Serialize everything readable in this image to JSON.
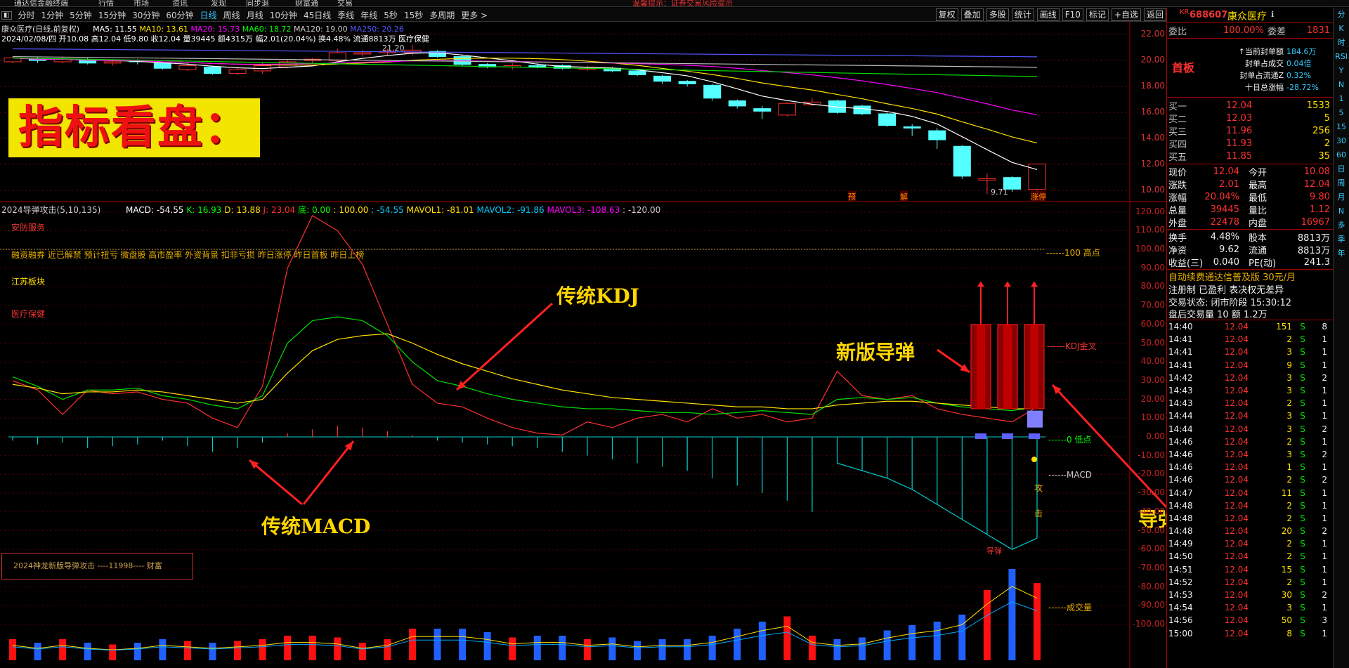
{
  "top_menu": [
    "通达信金融终端",
    "行情",
    "市场",
    "资讯",
    "发现",
    "同步退",
    "财富通",
    "交易",
    "温馨提示：证券交易风险提示"
  ],
  "toolbar": {
    "periods": [
      "分时",
      "1分钟",
      "5分钟",
      "15分钟",
      "30分钟",
      "60分钟",
      "日线",
      "周线",
      "月线",
      "10分钟",
      "45日线",
      "季线",
      "年线",
      "5秒",
      "15秒",
      "多周期",
      "更多 >"
    ],
    "right_buttons": [
      "复权",
      "叠加",
      "多股",
      "统计",
      "画线",
      "F10",
      "标记",
      "+自选",
      "返回"
    ]
  },
  "info_line1": {
    "name": "康众医疗(日线,前复权)",
    "ma5": "MA5: 11.55",
    "ma10": "MA10: 13.61",
    "ma20": "MA20: 15.73",
    "ma60": "MA60: 18.72",
    "ma120": "MA120: 19.00",
    "ma250": "MA250: 20.26"
  },
  "info_line2": "2024/02/08/四 开10.08 高12.04 低9.80 收12.04 量39445 额4315万 幅2.01(20.04%) 换4.48% 流通8813万 医疗保健",
  "title_box": "指标看盘：",
  "price_axis": [
    "22.00",
    "20.00",
    "18.00",
    "16.00",
    "14.00",
    "12.00",
    "10.00"
  ],
  "price_annotations": {
    "high": "21.20",
    "low": "9.71",
    "tag1": "预",
    "tag2": "解",
    "tag3": "涨停"
  },
  "indicator_line": {
    "name": "2024导弹攻击(5,10,135)",
    "macd": "MACD: -54.55",
    "k": "K: 16.93",
    "d": "D: 13.88",
    "j": "J: 23.04",
    "bottom": "底: 0.00",
    "p100": ": 100.00",
    "v1": ": -54.55",
    "mavol1": "MAVOL1: -81.01",
    "mavol2": "MAVOL2: -91.86",
    "mavol3": "MAVOL3: -108.63",
    "v2": ": -120.00"
  },
  "left_labels": {
    "l1": "安防服务",
    "l2": "融资融券 近已解禁 预计扭亏 微盘股 高市盈率 外资背景 扣非亏损 昨日涨停 昨日首板 昨日上榜",
    "l3": "江苏板块",
    "l4": "医疗保健"
  },
  "indicator_axis": [
    "120.00",
    "110.00",
    "100.00",
    "90.00",
    "80.00",
    "70.00",
    "60.00",
    "50.00",
    "40.00",
    "30.00",
    "20.00",
    "10.00",
    "0.00",
    "-10.00",
    "-20.00",
    "-30.00",
    "-40.00",
    "-50.00",
    "-60.00",
    "-70.00",
    "-80.00",
    "-90.00",
    "-100.00"
  ],
  "chart_labels": {
    "high_line": "------100 高点",
    "kdj_cross": "------KDJ金叉",
    "low_line": "------0 低点",
    "macd": "------MACD",
    "volume": "------成交量",
    "attack1": "攻",
    "attack2": "击",
    "missile_tag": "导弹"
  },
  "annotations": {
    "kdj": "传统KDJ",
    "macd": "传统MACD",
    "new_missile": "新版导弹",
    "missile_attack": "导弹攻击"
  },
  "legend_box": "2024神龙新版导弹攻击   ----11998---- 财富",
  "quote": {
    "code": "688607",
    "name": "康众医疗",
    "kr": "KR",
    "weibi_label": "委比",
    "weibi": "100.00%",
    "weicha_label": "委差",
    "weicha": "1831",
    "shouban": "首板",
    "seal_info": [
      [
        "↑当前封单额",
        "184.6万"
      ],
      [
        "封单占成交",
        "0.04倍"
      ],
      [
        "封单占流通Z",
        "0.32%"
      ],
      [
        "十日总涨幅",
        "-28.72%"
      ]
    ],
    "bids": [
      [
        "买一",
        "12.04",
        "1533"
      ],
      [
        "买二",
        "12.03",
        "5"
      ],
      [
        "买三",
        "11.96",
        "256"
      ],
      [
        "买四",
        "11.93",
        "2"
      ],
      [
        "买五",
        "11.85",
        "35"
      ]
    ],
    "stats": [
      [
        "现价",
        "12.04",
        "今开",
        "10.08"
      ],
      [
        "涨跌",
        "2.01",
        "最高",
        "12.04"
      ],
      [
        "涨幅",
        "20.04%",
        "最低",
        "9.80"
      ],
      [
        "总量",
        "39445",
        "量比",
        "1.12"
      ],
      [
        "外盘",
        "22478",
        "内盘",
        "16967"
      ]
    ],
    "stats2": [
      [
        "换手",
        "4.48%",
        "股本",
        "8813万"
      ],
      [
        "净资",
        "9.62",
        "流通",
        "8813万"
      ],
      [
        "收益(三)",
        "0.040",
        "PE(动)",
        "241.3"
      ]
    ],
    "ad": "自动续费通达信普及版  30元/月",
    "reg": "注册制 已盈利 表决权无差异",
    "status": "交易状态: 闭市阶段 15:30:12",
    "after": "盘后交易量 10 额 1.2万"
  },
  "ticks": [
    [
      "14:40",
      "12.04",
      "151",
      "S",
      "8"
    ],
    [
      "14:41",
      "12.04",
      "2",
      "S",
      "1"
    ],
    [
      "14:41",
      "12.04",
      "3",
      "S",
      "1"
    ],
    [
      "14:41",
      "12.04",
      "9",
      "S",
      "1"
    ],
    [
      "14:42",
      "12.04",
      "3",
      "S",
      "2"
    ],
    [
      "14:43",
      "12.04",
      "3",
      "S",
      "1"
    ],
    [
      "14:43",
      "12.04",
      "2",
      "S",
      "1"
    ],
    [
      "14:44",
      "12.04",
      "3",
      "S",
      "1"
    ],
    [
      "14:44",
      "12.04",
      "3",
      "S",
      "2"
    ],
    [
      "14:46",
      "12.04",
      "2",
      "S",
      "1"
    ],
    [
      "14:46",
      "12.04",
      "3",
      "S",
      "2"
    ],
    [
      "14:46",
      "12.04",
      "1",
      "S",
      "1"
    ],
    [
      "14:46",
      "12.04",
      "2",
      "S",
      "2"
    ],
    [
      "14:47",
      "12.04",
      "11",
      "S",
      "1"
    ],
    [
      "14:48",
      "12.04",
      "2",
      "S",
      "1"
    ],
    [
      "14:48",
      "12.04",
      "2",
      "S",
      "1"
    ],
    [
      "14:48",
      "12.04",
      "20",
      "S",
      "2"
    ],
    [
      "14:49",
      "12.04",
      "2",
      "S",
      "1"
    ],
    [
      "14:50",
      "12.04",
      "2",
      "S",
      "1"
    ],
    [
      "14:51",
      "12.04",
      "15",
      "S",
      "1"
    ],
    [
      "14:52",
      "12.04",
      "2",
      "S",
      "1"
    ],
    [
      "14:53",
      "12.04",
      "30",
      "S",
      "2"
    ],
    [
      "14:54",
      "12.04",
      "3",
      "S",
      "1"
    ],
    [
      "14:56",
      "12.04",
      "50",
      "S",
      "3"
    ],
    [
      "15:00",
      "12.04",
      "8",
      "S",
      "1"
    ]
  ],
  "right_tools": [
    "分",
    "K",
    "时",
    "RSI",
    "Y",
    "N",
    "1",
    "5",
    "15",
    "30",
    "60",
    "日",
    "周",
    "月",
    "N",
    "多",
    "季",
    "年"
  ],
  "candles": [
    {
      "o": 19.9,
      "c": 20.2,
      "h": 20.3,
      "l": 19.8
    },
    {
      "o": 20.1,
      "c": 20.0,
      "h": 20.3,
      "l": 19.8
    },
    {
      "o": 19.9,
      "c": 20.1,
      "h": 20.3,
      "l": 19.8
    },
    {
      "o": 20.0,
      "c": 19.8,
      "h": 20.2,
      "l": 19.7
    },
    {
      "o": 19.8,
      "c": 19.9,
      "h": 20.1,
      "l": 19.6
    },
    {
      "o": 20.0,
      "c": 19.9,
      "h": 20.1,
      "l": 19.7
    },
    {
      "o": 19.8,
      "c": 19.4,
      "h": 19.9,
      "l": 19.3
    },
    {
      "o": 19.3,
      "c": 19.6,
      "h": 19.8,
      "l": 19.2
    },
    {
      "o": 19.5,
      "c": 19.0,
      "h": 19.6,
      "l": 18.9
    },
    {
      "o": 19.0,
      "c": 19.3,
      "h": 19.5,
      "l": 18.9
    },
    {
      "o": 19.2,
      "c": 19.6,
      "h": 19.8,
      "l": 19.0
    },
    {
      "o": 19.5,
      "c": 19.9,
      "h": 20.0,
      "l": 19.4
    },
    {
      "o": 20.0,
      "c": 20.1,
      "h": 20.2,
      "l": 19.8
    },
    {
      "o": 20.0,
      "c": 20.6,
      "h": 20.9,
      "l": 19.9
    },
    {
      "o": 20.5,
      "c": 20.6,
      "h": 20.8,
      "l": 20.3
    },
    {
      "o": 20.6,
      "c": 20.7,
      "h": 20.9,
      "l": 20.4
    },
    {
      "o": 20.6,
      "c": 20.8,
      "h": 21.2,
      "l": 20.4
    },
    {
      "o": 20.7,
      "c": 20.3,
      "h": 20.8,
      "l": 20.2
    },
    {
      "o": 20.3,
      "c": 19.7,
      "h": 20.4,
      "l": 19.6
    },
    {
      "o": 19.7,
      "c": 19.5,
      "h": 19.8,
      "l": 19.4
    },
    {
      "o": 19.5,
      "c": 19.6,
      "h": 19.8,
      "l": 19.3
    },
    {
      "o": 19.6,
      "c": 19.5,
      "h": 19.8,
      "l": 19.4
    },
    {
      "o": 19.6,
      "c": 19.4,
      "h": 19.7,
      "l": 19.3
    },
    {
      "o": 19.4,
      "c": 19.4,
      "h": 19.6,
      "l": 19.2
    },
    {
      "o": 19.4,
      "c": 19.2,
      "h": 19.5,
      "l": 19.1
    },
    {
      "o": 19.2,
      "c": 18.9,
      "h": 19.3,
      "l": 18.8
    },
    {
      "o": 18.8,
      "c": 18.4,
      "h": 18.9,
      "l": 18.2
    },
    {
      "o": 18.4,
      "c": 18.2,
      "h": 18.5,
      "l": 18.0
    },
    {
      "o": 18.1,
      "c": 17.1,
      "h": 18.2,
      "l": 16.9
    },
    {
      "o": 16.9,
      "c": 16.5,
      "h": 17.0,
      "l": 16.3
    },
    {
      "o": 16.3,
      "c": 16.1,
      "h": 16.5,
      "l": 15.5
    },
    {
      "o": 15.8,
      "c": 16.7,
      "h": 16.8,
      "l": 15.7
    },
    {
      "o": 16.6,
      "c": 16.8,
      "h": 17.1,
      "l": 16.5
    },
    {
      "o": 16.9,
      "c": 16.0,
      "h": 17.0,
      "l": 15.9
    },
    {
      "o": 16.5,
      "c": 15.9,
      "h": 16.6,
      "l": 15.8
    },
    {
      "o": 15.9,
      "c": 15.0,
      "h": 16.0,
      "l": 14.9
    },
    {
      "o": 14.9,
      "c": 14.8,
      "h": 15.1,
      "l": 14.2
    },
    {
      "o": 14.6,
      "c": 13.9,
      "h": 14.8,
      "l": 13.2
    },
    {
      "o": 13.4,
      "c": 11.1,
      "h": 13.5,
      "l": 10.9
    },
    {
      "o": 10.8,
      "c": 10.9,
      "h": 11.3,
      "l": 9.71
    },
    {
      "o": 11.0,
      "c": 10.1,
      "h": 11.1,
      "l": 9.9
    },
    {
      "o": 10.08,
      "c": 12.04,
      "h": 12.04,
      "l": 9.8
    }
  ]
}
